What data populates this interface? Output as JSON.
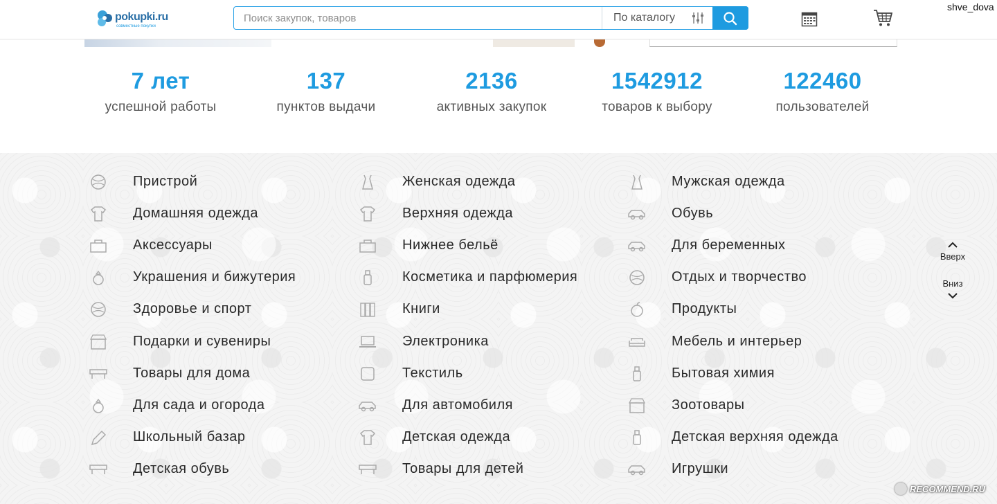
{
  "header": {
    "logo_text": "pokupki.ru",
    "logo_subtitle": "совместные покупки",
    "search_placeholder": "Поиск закупок, товаров",
    "catalog_label": "По каталогу",
    "username": "shve_dova"
  },
  "stats": [
    {
      "value": "7 лет",
      "label": "успешной работы"
    },
    {
      "value": "137",
      "label": "пунктов выдачи"
    },
    {
      "value": "2136",
      "label": "активных закупок"
    },
    {
      "value": "1542912",
      "label": "товаров к выбору"
    },
    {
      "value": "122460",
      "label": "пользователей"
    }
  ],
  "categories": {
    "col1": [
      {
        "label": "Пристрой",
        "icon": "percent-gear-icon"
      },
      {
        "label": "Домашняя одежда",
        "icon": "tshirt-icon"
      },
      {
        "label": "Аксессуары",
        "icon": "bag-icon"
      },
      {
        "label": "Украшения и бижутерия",
        "icon": "ring-icon"
      },
      {
        "label": "Здоровье и спорт",
        "icon": "ball-icon"
      },
      {
        "label": "Подарки и сувениры",
        "icon": "shop-icon"
      },
      {
        "label": "Товары для дома",
        "icon": "shelf-icon"
      },
      {
        "label": "Для сада и огорода",
        "icon": "flower-pot-icon"
      },
      {
        "label": "Школьный базар",
        "icon": "pencil-icon"
      },
      {
        "label": "Детская обувь",
        "icon": "kids-shoes-icon"
      }
    ],
    "col2": [
      {
        "label": "Женская одежда",
        "icon": "dress-icon"
      },
      {
        "label": "Верхняя одежда",
        "icon": "jacket-icon"
      },
      {
        "label": "Нижнее бельё",
        "icon": "bra-icon"
      },
      {
        "label": "Косметика и парфюмерия",
        "icon": "cosmetics-icon"
      },
      {
        "label": "Книги",
        "icon": "books-icon"
      },
      {
        "label": "Электроника",
        "icon": "laptop-icon"
      },
      {
        "label": "Текстиль",
        "icon": "textile-icon"
      },
      {
        "label": "Для автомобиля",
        "icon": "car-icon"
      },
      {
        "label": "Детская одежда",
        "icon": "kids-tshirt-icon"
      },
      {
        "label": "Товары для детей",
        "icon": "stroller-icon"
      }
    ],
    "col3": [
      {
        "label": "Мужская одежда",
        "icon": "shirt-icon"
      },
      {
        "label": "Обувь",
        "icon": "shoe-icon"
      },
      {
        "label": "Для беременных",
        "icon": "baby-carriage-icon"
      },
      {
        "label": "Отдых и творчество",
        "icon": "palette-icon"
      },
      {
        "label": "Продукты",
        "icon": "apple-icon"
      },
      {
        "label": "Мебель и интерьер",
        "icon": "sofa-icon"
      },
      {
        "label": "Бытовая химия",
        "icon": "bottle-icon"
      },
      {
        "label": "Зоотовары",
        "icon": "dog-icon"
      },
      {
        "label": "Детская верхняя одежда",
        "icon": "kids-coat-icon"
      },
      {
        "label": "Игрушки",
        "icon": "rocking-horse-icon"
      }
    ]
  },
  "scroll_nav": {
    "up_label": "Вверх",
    "down_label": "Вниз"
  },
  "watermark": "RECOMMEND.RU",
  "colors": {
    "accent": "#1e9be0",
    "category_bg": "#f2f2f2",
    "text": "#2a2a2a"
  }
}
